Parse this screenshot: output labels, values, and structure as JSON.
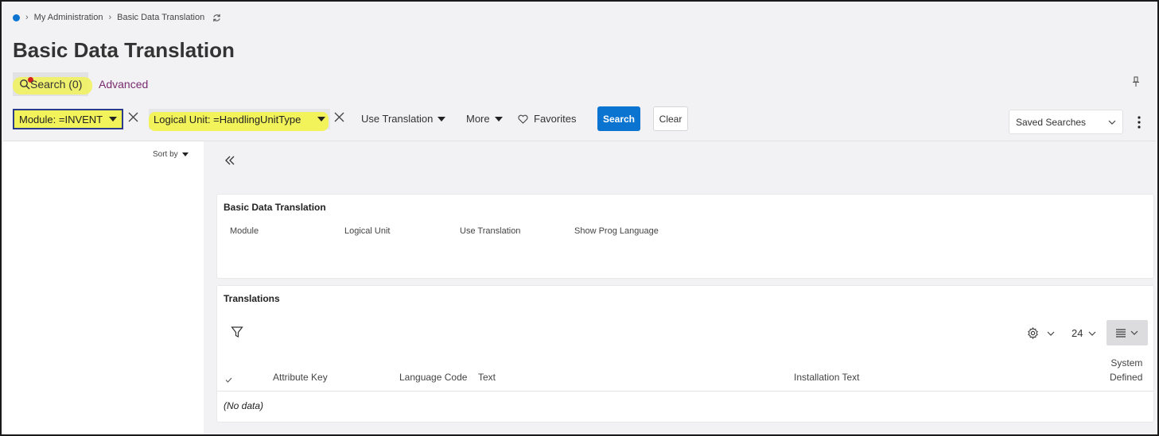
{
  "breadcrumb": {
    "items": [
      "My Administration",
      "Basic Data Translation"
    ]
  },
  "page": {
    "title": "Basic Data Translation"
  },
  "search_tabs": {
    "search_label": "Search (0)",
    "advanced_label": "Advanced"
  },
  "filters": {
    "module_chip": "Module: =INVENT",
    "logical_unit_chip": "Logical Unit: =HandlingUnitType",
    "use_translation": "Use Translation",
    "more": "More",
    "favorites": "Favorites",
    "search_button": "Search",
    "clear_button": "Clear",
    "saved_searches": "Saved Searches"
  },
  "side_panel": {
    "sort_by": "Sort by"
  },
  "main_card": {
    "title": "Basic Data Translation",
    "fields": [
      "Module",
      "Logical Unit",
      "Use Translation",
      "Show Prog Language"
    ]
  },
  "translations": {
    "title": "Translations",
    "page_size": "24",
    "columns": {
      "attribute_key": "Attribute Key",
      "language_code": "Language Code",
      "text": "Text",
      "installation_text": "Installation Text",
      "system_defined_1": "System",
      "system_defined_2": "Defined"
    },
    "empty_message": "(No data)"
  },
  "colors": {
    "accent": "#0b74d1",
    "advanced_link": "#7a2a6e",
    "highlight": "#f2f25a",
    "page_bg": "#f2f2f4"
  },
  "icons": [
    "home-dot-icon",
    "chevron-right-icon",
    "refresh-icon",
    "search-icon",
    "pin-icon",
    "close-icon",
    "caret-down-icon",
    "heart-icon",
    "kebab-icon",
    "double-chevron-left-icon",
    "filter-icon",
    "gear-icon",
    "chevron-down-icon",
    "list-view-icon",
    "check-icon"
  ]
}
